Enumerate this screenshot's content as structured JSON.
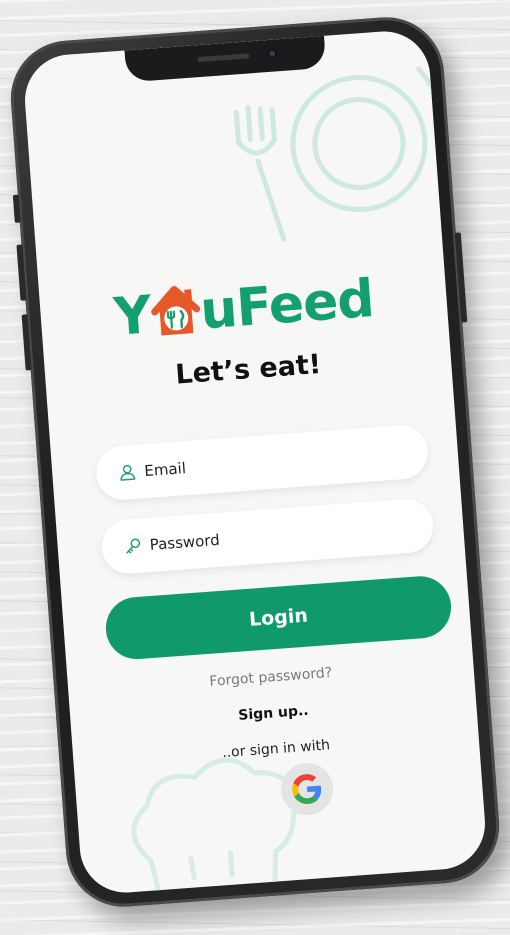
{
  "app": {
    "name": "YouFeed",
    "logo_left": "Y",
    "logo_right": "uFeed",
    "tagline": "Let’s eat!"
  },
  "form": {
    "email_placeholder": "Email",
    "password_placeholder": "Password",
    "login_label": "Login",
    "forgot_label": "Forgot password?",
    "signup_label": "Sign up..",
    "alt_signin_label": "..or sign in with"
  },
  "icons": {
    "email": "user-icon",
    "password": "key-icon",
    "google": "google-icon",
    "decor": [
      "fork-icon",
      "plate-icon",
      "knife-icon",
      "chef-hat-icon"
    ]
  },
  "colors": {
    "brand_green": "#109a6b",
    "logo_orange": "#e6582a",
    "background": "#f7f7f6"
  }
}
